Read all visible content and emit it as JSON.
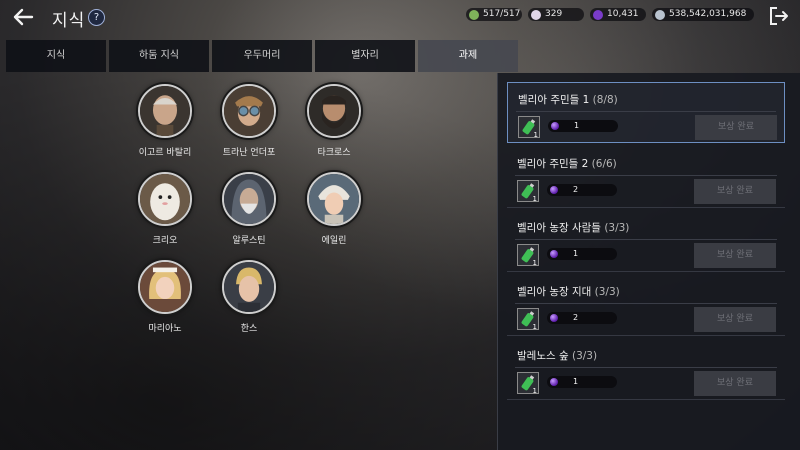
{
  "header": {
    "title": "지식",
    "help_icon_text": "?"
  },
  "currencies": [
    {
      "icon": "energy-icon",
      "value": "517/517",
      "color": "#7fb35a"
    },
    {
      "icon": "pearl-icon",
      "value": "329",
      "color": "#e0d6e8"
    },
    {
      "icon": "black-orb-icon",
      "value": "10,431",
      "color": "#7a3cc9"
    },
    {
      "icon": "silver-icon",
      "value": "538,542,031,968",
      "color": "#b9c3cf"
    }
  ],
  "tabs": [
    {
      "label": "지식",
      "active": false
    },
    {
      "label": "하둠 지식",
      "active": false
    },
    {
      "label": "우두머리",
      "active": false
    },
    {
      "label": "별자리",
      "active": false
    },
    {
      "label": "과제",
      "active": true
    }
  ],
  "characters": [
    {
      "name": "이고르 바탈리",
      "portrait": "old-man-portrait-icon"
    },
    {
      "name": "트라난 언더포",
      "portrait": "goggles-man-portrait-icon"
    },
    {
      "name": "타크로스",
      "portrait": "bearded-warrior-portrait-icon"
    },
    {
      "name": "크리오",
      "portrait": "white-creature-portrait-icon"
    },
    {
      "name": "알루스틴",
      "portrait": "hooded-elder-portrait-icon"
    },
    {
      "name": "에일린",
      "portrait": "turban-woman-portrait-icon"
    },
    {
      "name": "마리아노",
      "portrait": "blonde-girl-portrait-icon"
    },
    {
      "name": "한스",
      "portrait": "blonde-man-portrait-icon"
    }
  ],
  "quests": [
    {
      "title": "벨리아 주민들 1",
      "progress": "(8/8)",
      "reward_count": "1",
      "reward_amount": "1",
      "button": "보상 완료",
      "selected": true
    },
    {
      "title": "벨리아 주민들 2",
      "progress": "(6/6)",
      "reward_count": "1",
      "reward_amount": "2",
      "button": "보상 완료",
      "selected": false
    },
    {
      "title": "벨리아 농장 사람들",
      "progress": "(3/3)",
      "reward_count": "1",
      "reward_amount": "1",
      "button": "보상 완료",
      "selected": false
    },
    {
      "title": "벨리아 농장 지대",
      "progress": "(3/3)",
      "reward_count": "1",
      "reward_amount": "2",
      "button": "보상 완료",
      "selected": false
    },
    {
      "title": "발레노스 숲",
      "progress": "(3/3)",
      "reward_count": "1",
      "reward_amount": "1",
      "button": "보상 완료",
      "selected": false
    }
  ],
  "reward_item_icon": "green-potion-icon",
  "reward_currency_icon": "black-orb-icon"
}
